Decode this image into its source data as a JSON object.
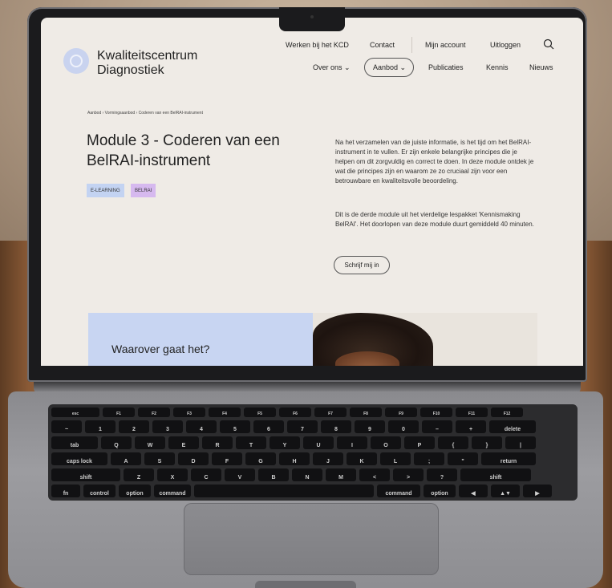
{
  "site": {
    "brand_line1": "Kwaliteitscentrum",
    "brand_line2": "Diagnostiek",
    "top_nav": [
      "Werken bij het KCD",
      "Contact",
      "Mijn account",
      "Uitloggen"
    ],
    "main_nav": {
      "over_ons": "Over ons",
      "aanbod": "Aanbod",
      "publicaties": "Publicaties",
      "kennis": "Kennis",
      "nieuws": "Nieuws"
    },
    "breadcrumb": "Aanbod › Vormingsaanbod › Coderen van een BelRAI-instrument",
    "title": "Module 3 - Coderen van een BelRAI-instrument",
    "tags": [
      "E-LEARNING",
      "BELRAI"
    ],
    "intro_p1": "Na het verzamelen van de juiste informatie, is het tijd om het BelRAI-instrument in te vullen. Er zijn enkele belangrijke principes die je helpen om dit zorgvuldig en correct te doen. In deze module ontdek je wat die principes zijn en waarom ze zo cruciaal zijn voor een betrouwbare en kwaliteitsvolle beoordeling.",
    "intro_p2": "Dit is de derde module uit het vierdelige lespakket 'Kennismaking BelRAI'. Het doorlopen van deze module duurt gemiddeld 40 minuten.",
    "cta_label": "Schrijf mij in",
    "section_heading": "Waarover gaat het?"
  },
  "keyboard": {
    "fn_row": [
      "esc",
      "F1",
      "F2",
      "F3",
      "F4",
      "F5",
      "F6",
      "F7",
      "F8",
      "F9",
      "F10",
      "F11",
      "F12"
    ],
    "num_row": [
      "~",
      "1",
      "2",
      "3",
      "4",
      "5",
      "6",
      "7",
      "8",
      "9",
      "0",
      "–",
      "+",
      "delete"
    ],
    "top_row": [
      "tab",
      "Q",
      "W",
      "E",
      "R",
      "T",
      "Y",
      "U",
      "I",
      "O",
      "P",
      "{",
      "}",
      "|"
    ],
    "home_row": [
      "caps lock",
      "A",
      "S",
      "D",
      "F",
      "G",
      "H",
      "J",
      "K",
      "L",
      ";",
      "\"",
      "return"
    ],
    "bottom_row": [
      "shift",
      "Z",
      "X",
      "C",
      "V",
      "B",
      "N",
      "M",
      "<",
      ">",
      "?",
      "shift"
    ],
    "mod_row": [
      "fn",
      "control",
      "option",
      "command",
      "",
      "command",
      "option",
      "◀",
      "▲▼",
      "▶"
    ]
  },
  "colors": {
    "screen_bg": "#efebe6",
    "tag_elearning": "#c3d3f2",
    "tag_belrai": "#d6b9ef",
    "panel_blue": "#c8d5f2"
  }
}
